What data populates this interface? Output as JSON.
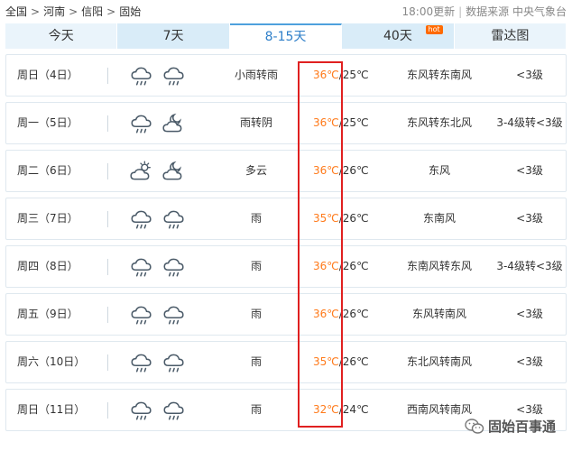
{
  "breadcrumb": [
    "全国",
    "河南",
    "信阳",
    "固始"
  ],
  "breadcrumb_sep": ">",
  "meta": {
    "updated": "18:00更新",
    "source": "数据来源 中央气象台"
  },
  "tabs": [
    {
      "label": "今天"
    },
    {
      "label": "7天"
    },
    {
      "label": "8-15天"
    },
    {
      "label": "40天",
      "badge": "hot"
    },
    {
      "label": "雷达图"
    }
  ],
  "rows": [
    {
      "day": "周日（4日）",
      "cond": "小雨转雨",
      "hi": "36℃",
      "lo": "25℃",
      "wind": "东风转东南风",
      "level": "<3级",
      "icon1": "rain-cloud-icon",
      "icon2": "rain-cloud-icon"
    },
    {
      "day": "周一（5日）",
      "cond": "雨转阴",
      "hi": "36℃",
      "lo": "25℃",
      "wind": "东风转东北风",
      "level": "3-4级转<3级",
      "icon1": "rain-cloud-icon",
      "icon2": "moon-cloud-icon"
    },
    {
      "day": "周二（6日）",
      "cond": "多云",
      "hi": "36℃",
      "lo": "26℃",
      "wind": "东风",
      "level": "<3级",
      "icon1": "sun-cloud-icon",
      "icon2": "moon-cloud-icon"
    },
    {
      "day": "周三（7日）",
      "cond": "雨",
      "hi": "35℃",
      "lo": "26℃",
      "wind": "东南风",
      "level": "<3级",
      "icon1": "rain-cloud-icon",
      "icon2": "rain-cloud-icon"
    },
    {
      "day": "周四（8日）",
      "cond": "雨",
      "hi": "36℃",
      "lo": "26℃",
      "wind": "东南风转东风",
      "level": "3-4级转<3级",
      "icon1": "rain-cloud-icon",
      "icon2": "rain-cloud-icon"
    },
    {
      "day": "周五（9日）",
      "cond": "雨",
      "hi": "36℃",
      "lo": "26℃",
      "wind": "东风转南风",
      "level": "<3级",
      "icon1": "rain-cloud-icon",
      "icon2": "rain-cloud-icon"
    },
    {
      "day": "周六（10日）",
      "cond": "雨",
      "hi": "35℃",
      "lo": "26℃",
      "wind": "东北风转南风",
      "level": "<3级",
      "icon1": "rain-cloud-icon",
      "icon2": "rain-cloud-icon"
    },
    {
      "day": "周日（11日）",
      "cond": "雨",
      "hi": "32℃",
      "lo": "24℃",
      "wind": "西南风转南风",
      "level": "<3级",
      "icon1": "rain-cloud-icon",
      "icon2": "rain-cloud-icon"
    }
  ],
  "watermark": {
    "text": "固始百事通"
  },
  "colors": {
    "accent": "#2e7fc9",
    "tab_bg": "#eaf4fb",
    "hi_temp": "#ff7a1a",
    "highlight": "#e02020"
  }
}
